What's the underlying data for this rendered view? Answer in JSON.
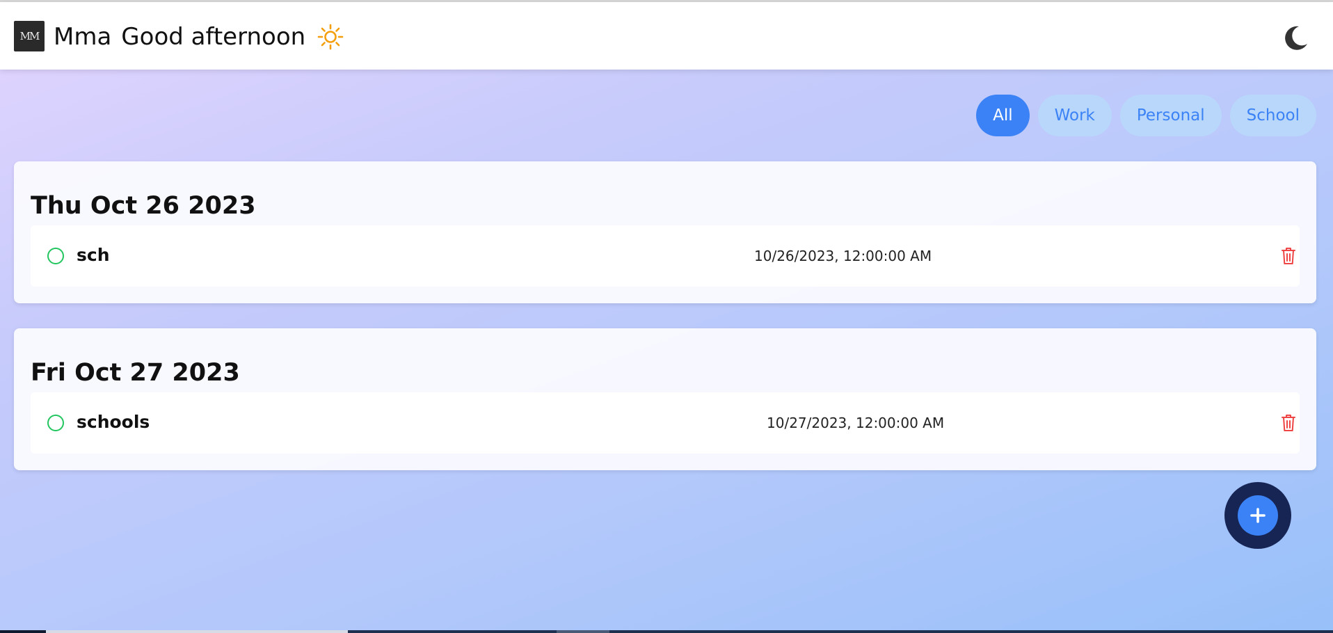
{
  "header": {
    "logo_text": "MM",
    "user_name": "Mma",
    "greeting": "Good afternoon",
    "sun_icon": "sun-icon",
    "theme_toggle_icon": "moon-icon"
  },
  "filters": [
    {
      "label": "All",
      "active": true
    },
    {
      "label": "Work",
      "active": false
    },
    {
      "label": "Personal",
      "active": false
    },
    {
      "label": "School",
      "active": false
    }
  ],
  "days": [
    {
      "title": "Thu Oct 26 2023",
      "tasks": [
        {
          "name": "sch",
          "datetime": "10/26/2023, 12:00:00 AM",
          "completed": false
        }
      ]
    },
    {
      "title": "Fri Oct 27 2023",
      "tasks": [
        {
          "name": "schools",
          "datetime": "10/27/2023, 12:00:00 AM",
          "completed": false
        }
      ]
    }
  ],
  "add_button_icon": "plus-icon",
  "colors": {
    "accent": "#3b82f6",
    "pill_inactive_bg": "#b9d7fb",
    "check_border": "#22c55e",
    "trash": "#ef4444",
    "fab_ring": "#172554",
    "sun": "#f59e0b",
    "moon": "#333333"
  }
}
